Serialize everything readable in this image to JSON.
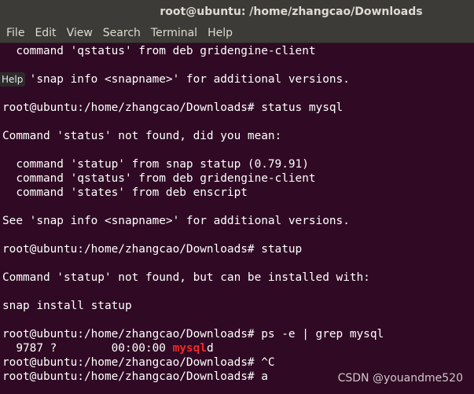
{
  "window": {
    "title": "root@ubuntu: /home/zhangcao/Downloads"
  },
  "menubar": {
    "items": [
      "File",
      "Edit",
      "View",
      "Search",
      "Terminal",
      "Help"
    ]
  },
  "tooltip": {
    "text": "Help"
  },
  "terminal": {
    "lines": [
      "  command 'qstatus' from deb gridengine-client",
      "",
      "See 'snap info <snapname>' for additional versions.",
      "",
      "root@ubuntu:/home/zhangcao/Downloads# status mysql",
      "",
      "Command 'status' not found, did you mean:",
      "",
      "  command 'statup' from snap statup (0.79.91)",
      "  command 'qstatus' from deb gridengine-client",
      "  command 'states' from deb enscript",
      "",
      "See 'snap info <snapname>' for additional versions.",
      "",
      "root@ubuntu:/home/zhangcao/Downloads# statup",
      "",
      "Command 'statup' not found, but can be installed with:",
      "",
      "snap install statup",
      "",
      "root@ubuntu:/home/zhangcao/Downloads# ps -e | grep mysql"
    ],
    "ps_line": {
      "prefix": "  9787 ?        00:00:00 ",
      "match": "mysql",
      "suffix": "d"
    },
    "tail_lines": [
      "root@ubuntu:/home/zhangcao/Downloads# ^C",
      "root@ubuntu:/home/zhangcao/Downloads# a"
    ]
  },
  "watermark": {
    "text": "CSDN @youandme520"
  },
  "colors": {
    "terminal_bg": "#300a24",
    "chrome_bg": "#3c3b37",
    "grep_match": "#ef2929"
  }
}
